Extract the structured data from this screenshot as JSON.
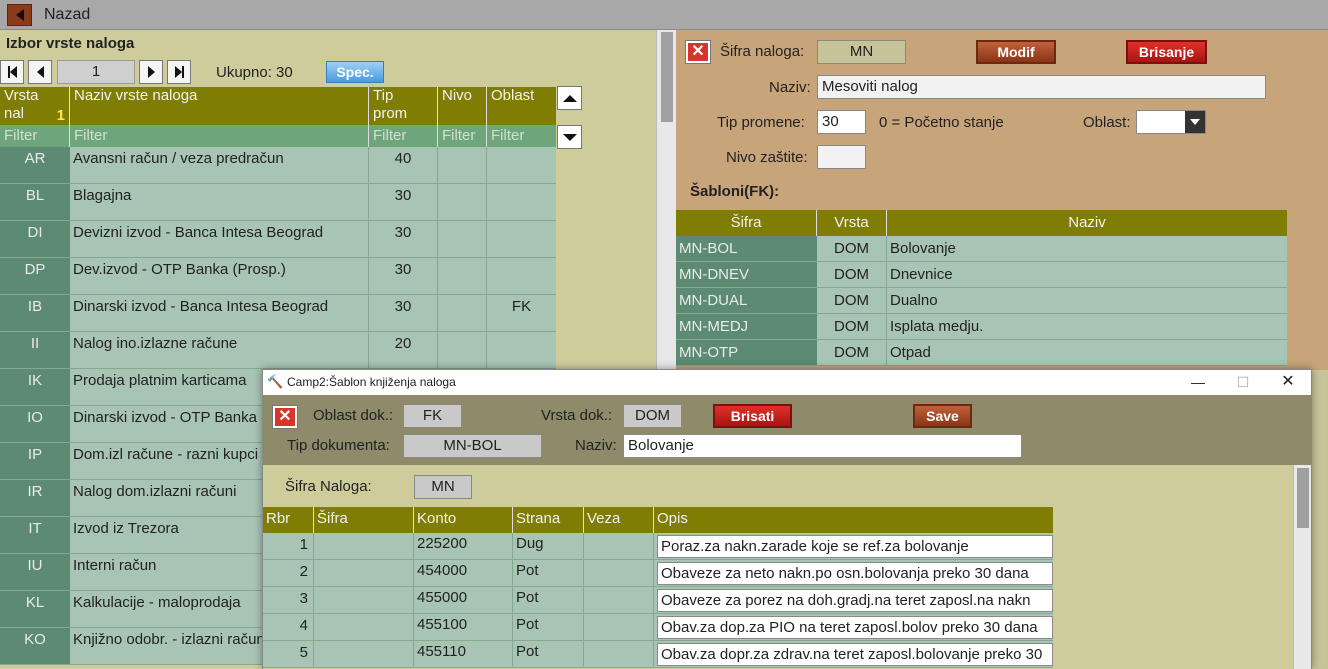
{
  "topbar": {
    "back_label": "Nazad"
  },
  "left": {
    "title": "Izbor vrste naloga",
    "page": "1",
    "count": "Ukupno: 30",
    "spec_label": "Spec.",
    "headers": {
      "code_line1": "Vrsta",
      "code_line2": "nal",
      "sort_indicator": "1",
      "name": "Naziv vrste naloga",
      "tip_line1": "Tip",
      "tip_line2": "prom",
      "nivo": "Nivo",
      "oblast": "Oblast"
    },
    "filter": "Filter",
    "rows": [
      {
        "code": "AR",
        "name": "Avansni račun / veza predračun",
        "tip": "40",
        "oblast": ""
      },
      {
        "code": "BL",
        "name": "Blagajna",
        "tip": "30",
        "oblast": ""
      },
      {
        "code": "DI",
        "name": "Devizni izvod - Banca Intesa Beograd",
        "tip": "30",
        "oblast": ""
      },
      {
        "code": "DP",
        "name": "Dev.izvod - OTP Banka (Prosp.)",
        "tip": "30",
        "oblast": ""
      },
      {
        "code": "IB",
        "name": "Dinarski izvod - Banca Intesa Beograd",
        "tip": "30",
        "oblast": "FK"
      },
      {
        "code": "II",
        "name": "Nalog ino.izlazne račune",
        "tip": "20",
        "oblast": ""
      },
      {
        "code": "IK",
        "name": "Prodaja platnim karticama",
        "tip": "",
        "oblast": ""
      },
      {
        "code": "IO",
        "name": "Dinarski izvod - OTP Banka",
        "tip": "",
        "oblast": ""
      },
      {
        "code": "IP",
        "name": "Dom.izl račune - razni kupci",
        "tip": "",
        "oblast": ""
      },
      {
        "code": "IR",
        "name": "Nalog dom.izlazni računi",
        "tip": "",
        "oblast": ""
      },
      {
        "code": "IT",
        "name": "Izvod iz Trezora",
        "tip": "",
        "oblast": ""
      },
      {
        "code": "IU",
        "name": "Interni račun",
        "tip": "",
        "oblast": ""
      },
      {
        "code": "KL",
        "name": "Kalkulacije - maloprodaja",
        "tip": "",
        "oblast": ""
      },
      {
        "code": "KO",
        "name": "Knjižno odobr. - izlazni računi",
        "tip": "",
        "oblast": ""
      }
    ]
  },
  "right": {
    "sifra_label": "Šifra naloga:",
    "sifra_value": "MN",
    "modif_label": "Modif",
    "brisanje_label": "Brisanje",
    "naziv_label": "Naziv:",
    "naziv_value": "Mesoviti nalog",
    "tip_label": "Tip promene:",
    "tip_value": "30",
    "tip_hint": "0 = Početno stanje",
    "oblast_label": "Oblast:",
    "nivo_label": "Nivo zaštite:",
    "sabloni_label": "Šabloni(FK):",
    "sab_headers": {
      "sifra": "Šifra",
      "vrsta": "Vrsta",
      "naziv": "Naziv"
    },
    "sab_rows": [
      {
        "sifra": "MN-BOL",
        "vrsta": "DOM",
        "naziv": "Bolovanje"
      },
      {
        "sifra": "MN-DNEV",
        "vrsta": "DOM",
        "naziv": "Dnevnice"
      },
      {
        "sifra": "MN-DUAL",
        "vrsta": "DOM",
        "naziv": "Dualno"
      },
      {
        "sifra": "MN-MEDJ",
        "vrsta": "DOM",
        "naziv": "Isplata medju."
      },
      {
        "sifra": "MN-OTP",
        "vrsta": "DOM",
        "naziv": "Otpad"
      }
    ]
  },
  "dialog": {
    "title": "Camp2:Šablon knjiženja naloga",
    "minimize": "—",
    "maximize": "☐",
    "close": "✕",
    "oblast_label": "Oblast dok.:",
    "oblast_value": "FK",
    "vrsta_label": "Vrsta dok.:",
    "vrsta_value": "DOM",
    "brisati_label": "Brisati",
    "save_label": "Save",
    "tipdok_label": "Tip dokumenta:",
    "tipdok_value": "MN-BOL",
    "naziv_label": "Naziv:",
    "naziv_value": "Bolovanje",
    "sifra_label": "Šifra Naloga:",
    "sifra_value": "MN",
    "headers": {
      "rbr": "Rbr",
      "sifra": "Šifra",
      "konto": "Konto",
      "strana": "Strana",
      "veza": "Veza",
      "opis": "Opis"
    },
    "rows": [
      {
        "rbr": "1",
        "konto": "225200",
        "strana": "Dug",
        "opis": "Poraz.za nakn.zarade koje se ref.za bolovanje"
      },
      {
        "rbr": "2",
        "konto": "454000",
        "strana": "Pot",
        "opis": "Obaveze za neto nakn.po osn.bolovanja preko 30 dana"
      },
      {
        "rbr": "3",
        "konto": "455000",
        "strana": "Pot",
        "opis": "Obaveze za porez na doh.gradj.na teret zaposl.na nakn"
      },
      {
        "rbr": "4",
        "konto": "455100",
        "strana": "Pot",
        "opis": "Obav.za dop.za PIO na teret zaposl.bolov preko 30 dana"
      },
      {
        "rbr": "5",
        "konto": "455110",
        "strana": "Pot",
        "opis": "Obav.za dopr.za zdrav.na teret zaposl.bolovanje preko 30"
      }
    ]
  },
  "colors": {
    "header_olive": "#807d05",
    "code_green": "#5c8a73",
    "cell_green": "#a8c4b4",
    "panel_khaki": "#cfcc9b",
    "panel_tan": "#c7a47a"
  }
}
